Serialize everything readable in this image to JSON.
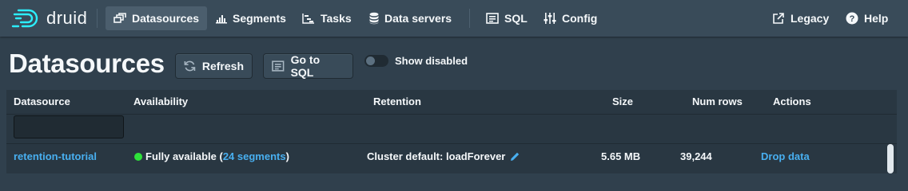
{
  "app": {
    "name": "druid"
  },
  "nav": {
    "datasources": "Datasources",
    "segments": "Segments",
    "tasks": "Tasks",
    "data_servers": "Data servers",
    "sql": "SQL",
    "config": "Config",
    "legacy": "Legacy",
    "help": "Help"
  },
  "page": {
    "title": "Datasources",
    "refresh": "Refresh",
    "go_to_sql": "Go to SQL",
    "show_disabled": "Show disabled",
    "show_disabled_on": false
  },
  "table": {
    "columns": [
      "Datasource",
      "Availability",
      "Retention",
      "Size",
      "Num rows",
      "Actions"
    ],
    "filter_value": "",
    "rows": [
      {
        "datasource": "retention-tutorial",
        "availability_prefix": "Fully available (",
        "availability_link": "24 segments",
        "availability_suffix": ")",
        "status_color": "#2ee23a",
        "retention": "Cluster default: loadForever",
        "size": "5.65 MB",
        "num_rows": "39,244",
        "action": "Drop data"
      }
    ]
  },
  "colors": {
    "background": "#30404d",
    "navbar": "#394b59",
    "link": "#48aff0",
    "accent": "#2ee23a"
  }
}
